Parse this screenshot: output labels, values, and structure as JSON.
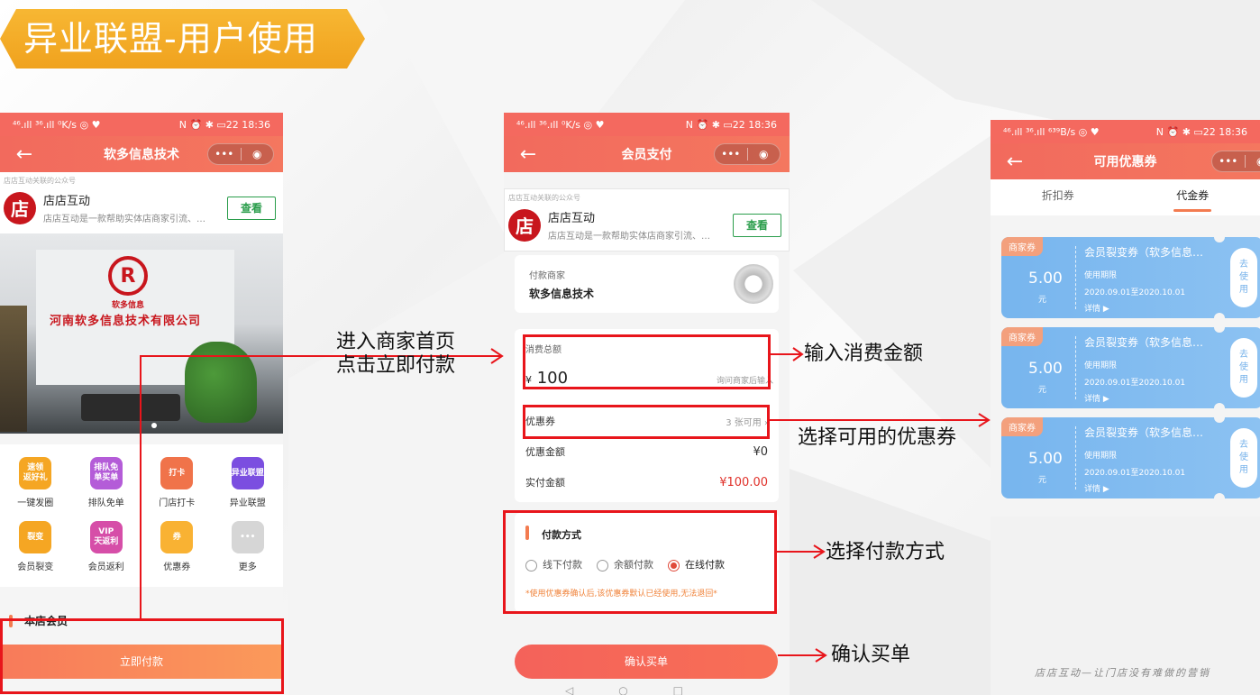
{
  "banner": {
    "title": "异业联盟-用户使用"
  },
  "colors": {
    "brand": "#f4695f",
    "accent": "#f0a21e",
    "coupon": "#77b5ee",
    "annotation": "#e8151b",
    "price": "#e0312a"
  },
  "status": {
    "left1": "⁴⁶.ıll ³⁶.ıll ⁰K/s ◎ ♥",
    "left3": "⁴⁶.ıll ³⁶.ıll ⁶³⁹B/s ◎ ♥",
    "right": "N ⏰ ✱ ▭22 18:36"
  },
  "oa": {
    "tip": "店店互动关联的公众号",
    "logo": "店",
    "name": "店店互动",
    "desc": "店店互动是一款帮助实体店商家引流、…",
    "button": "查看"
  },
  "phone1": {
    "nav_title": "软多信息技术",
    "photo": {
      "brand_sub": "软多信息",
      "company": "河南软多信息技术有限公司"
    },
    "menu": [
      {
        "label": "一键发圈",
        "icon_text": "速领\n返好礼",
        "icon": "gift-icon",
        "color": "#f5a623"
      },
      {
        "label": "排队免单",
        "icon_text": "排队免\n单买单",
        "icon": "queue-icon",
        "color": "#b45cd8"
      },
      {
        "label": "门店打卡",
        "icon_text": "打卡",
        "icon": "checkin-icon",
        "color": "#f0734a"
      },
      {
        "label": "异业联盟",
        "icon_text": "异业联盟",
        "icon": "alliance-icon",
        "color": "#7b4ee0"
      },
      {
        "label": "会员裂变",
        "icon_text": "裂变",
        "icon": "fission-icon",
        "color": "#f5a623"
      },
      {
        "label": "会员返利",
        "icon_text": "VIP\n天返利",
        "icon": "vip-icon",
        "color": "#d64ea8"
      },
      {
        "label": "优惠券",
        "icon_text": "券",
        "icon": "coupon-icon",
        "color": "#f9b233"
      },
      {
        "label": "更多",
        "icon_text": "•••",
        "icon": "more-icon",
        "color": "#d6d6d6"
      }
    ],
    "member_title": "本店会员",
    "pay_button": "立即付款"
  },
  "phone2": {
    "nav_title": "会员支付",
    "merchant_label": "付款商家",
    "merchant_name": "软多信息技术",
    "total_label": "消费总额",
    "currency": "¥",
    "total_value": "100",
    "total_hint": "询问商家后输入",
    "coupon_label": "优惠券",
    "coupon_value": "3 张可用",
    "discount_label": "优惠金额",
    "discount_value": "¥0",
    "actual_label": "实付金额",
    "actual_value": "¥100.00",
    "method_title": "付款方式",
    "methods": [
      "线下付款",
      "余额付款",
      "在线付款"
    ],
    "method_selected": "在线付款",
    "notice": "*使用优惠券确认后,该优惠券默认已经使用,无法退回*",
    "confirm_button": "确认买单"
  },
  "phone3": {
    "nav_title": "可用优惠券",
    "tabs": [
      "折扣券",
      "代金券"
    ],
    "active_tab": "代金券",
    "coupons": [
      {
        "tag": "商家券",
        "amount": "5.00",
        "unit": "元",
        "title": "会员裂变券（软多信息…",
        "period_label": "使用期限",
        "period": "2020.09.01至2020.10.01",
        "detail": "详情 ▶",
        "use": "去\n使\n用"
      },
      {
        "tag": "商家券",
        "amount": "5.00",
        "unit": "元",
        "title": "会员裂变券（软多信息…",
        "period_label": "使用期限",
        "period": "2020.09.01至2020.10.01",
        "detail": "详情 ▶",
        "use": "去\n使\n用"
      },
      {
        "tag": "商家券",
        "amount": "5.00",
        "unit": "元",
        "title": "会员裂变券（软多信息…",
        "period_label": "使用期限",
        "period": "2020.09.01至2020.10.01",
        "detail": "详情 ▶",
        "use": "去\n使\n用"
      }
    ]
  },
  "annotations": {
    "enter_line1": "进入商家首页",
    "enter_line2": "点击立即付款",
    "input_amount": "输入消费金额",
    "choose_coupon": "选择可用的优惠券",
    "choose_method": "选择付款方式",
    "confirm": "确认买单"
  },
  "footer": {
    "signature": "店店互动—让门店没有难做的营销"
  }
}
